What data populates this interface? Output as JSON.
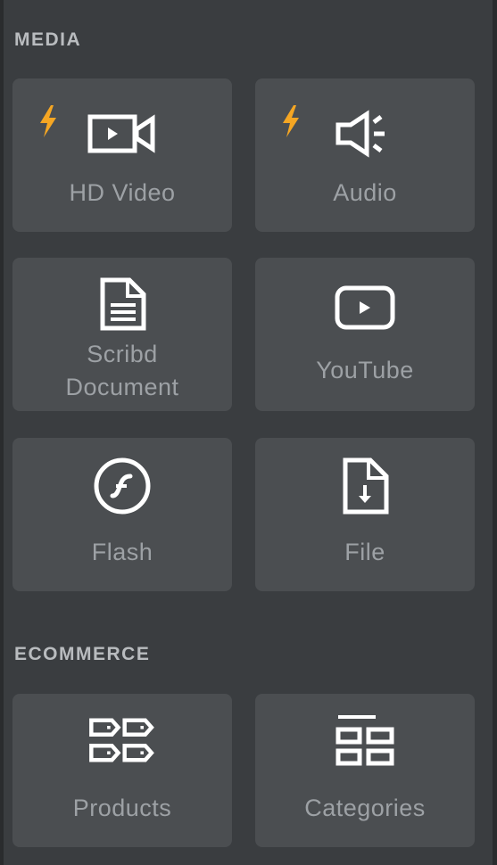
{
  "sections": [
    {
      "title": "MEDIA",
      "tiles": [
        {
          "label": "HD Video",
          "icon": "video-camera-icon",
          "premium": true
        },
        {
          "label": "Audio",
          "icon": "speaker-icon",
          "premium": true
        },
        {
          "label": "Scribd\nDocument",
          "icon": "document-icon",
          "premium": false
        },
        {
          "label": "YouTube",
          "icon": "youtube-play-icon",
          "premium": false
        },
        {
          "label": "Flash",
          "icon": "flash-icon",
          "premium": false
        },
        {
          "label": "File",
          "icon": "file-download-icon",
          "premium": false
        }
      ]
    },
    {
      "title": "ECOMMERCE",
      "tiles": [
        {
          "label": "Products",
          "icon": "product-tags-icon",
          "premium": false
        },
        {
          "label": "Categories",
          "icon": "categories-grid-icon",
          "premium": false
        }
      ]
    }
  ],
  "colors": {
    "panel": "#3a3d40",
    "tile": "#4b4e51",
    "icon": "#ffffff",
    "label": "#9da1a5",
    "section_title": "#b9bcbf",
    "premium_bolt": "#f5a623"
  }
}
